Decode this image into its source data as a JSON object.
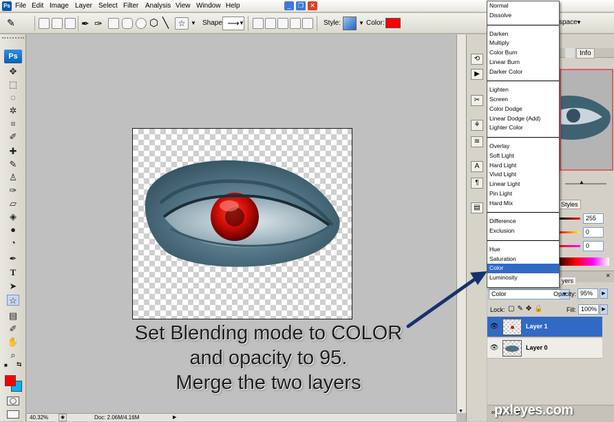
{
  "menubar": {
    "items": [
      "File",
      "Edit",
      "Image",
      "Layer",
      "Select",
      "Filter",
      "Analysis",
      "View",
      "Window",
      "Help"
    ],
    "workspace_label": "space"
  },
  "options": {
    "shape_label": "Shape:",
    "style_label": "Style:",
    "color_label": "Color:",
    "color_value": "#ff0000"
  },
  "tools": {
    "logo": "Ps"
  },
  "instruction": {
    "line1": "Set Blending mode to COLOR",
    "line2": "and opacity to 95.",
    "line3": "Merge the two  layers"
  },
  "status": {
    "zoom": "40.32%",
    "doc": "Doc: 2.06M/4.16M"
  },
  "panels": {
    "tabs_top": [
      "Info"
    ],
    "styles_tab": "Styles",
    "color_values": [
      "255",
      "0",
      "0"
    ],
    "layers_tab": "yers",
    "blend_mode": "Color",
    "opacity_label": "Opacity:",
    "opacity_value": "95%",
    "lock_label": "Lock:",
    "fill_label": "Fill:",
    "fill_value": "100%",
    "layers": [
      {
        "name": "Layer 1",
        "selected": true
      },
      {
        "name": "Layer 0",
        "selected": false
      }
    ]
  },
  "blend_modes": [
    [
      "Normal",
      "Dissolve"
    ],
    [
      "Darken",
      "Multiply",
      "Color Burn",
      "Linear Burn",
      "Darker Color"
    ],
    [
      "Lighten",
      "Screen",
      "Color Dodge",
      "Linear Dodge (Add)",
      "Lighter Color"
    ],
    [
      "Overlay",
      "Soft Light",
      "Hard Light",
      "Vivid Light",
      "Linear Light",
      "Pin Light",
      "Hard Mix"
    ],
    [
      "Difference",
      "Exclusion"
    ],
    [
      "Hue",
      "Saturation",
      "Color",
      "Luminosity"
    ]
  ],
  "blend_selected": "Color",
  "watermark": "pxleyes.com",
  "colors": {
    "accent": "#316ac5",
    "foreground": "#ff0000",
    "background": "#00b4ff",
    "arrow": "#16326e"
  }
}
